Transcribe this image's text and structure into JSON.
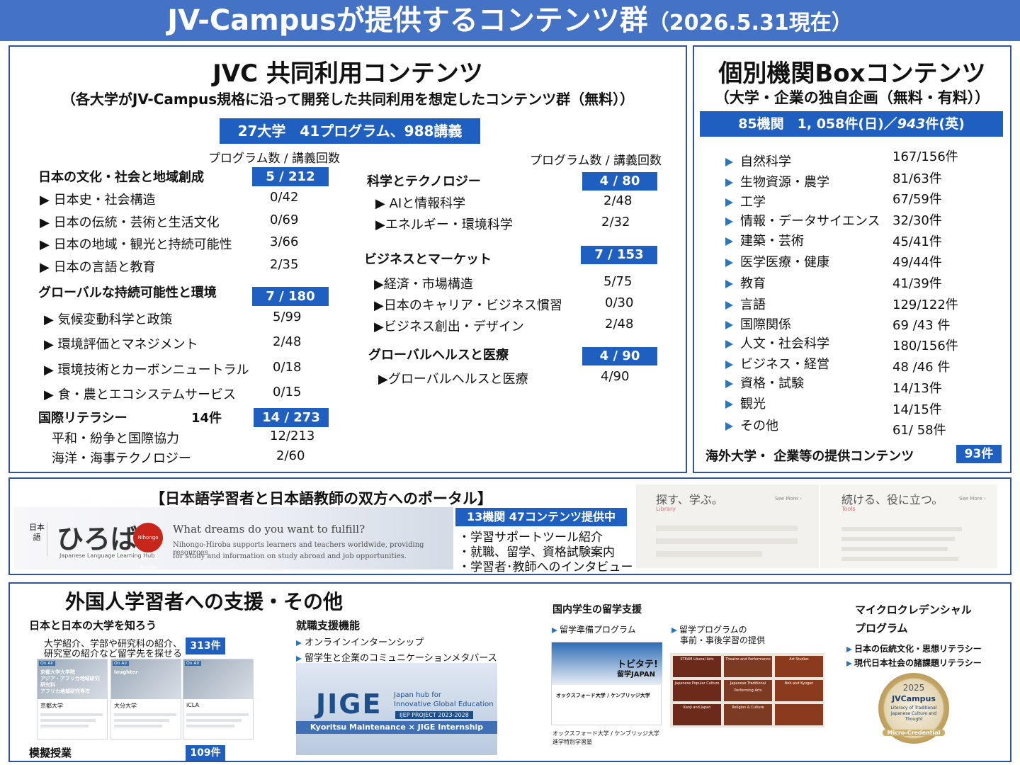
{
  "header": {
    "title": "JV-Campusが提供するコンテンツ群",
    "date": "（2026.5.31現在）"
  },
  "jvc": {
    "title": "JVC 共同利用コンテンツ",
    "subtitle": "（各大学がJV-Campus規格に沿って開発した共同利用を想定したコンテンツ群（無料））",
    "summary": "27大学　41プログラム、988講義",
    "col_header": "プログラム数 / 講義回数",
    "culture": {
      "name": "日本の文化・社会と地域創成",
      "badge": "5 / 212",
      "items": [
        {
          "label": "▶ 日本史・社会構造",
          "value": "0/42"
        },
        {
          "label": "▶ 日本の伝統・芸術と生活文化",
          "value": "0/69"
        },
        {
          "label": "▶ 日本の地域・観光と持続可能性",
          "value": "3/66"
        },
        {
          "label": "▶ 日本の言語と教育",
          "value": "2/35"
        }
      ]
    },
    "global": {
      "name": "グローバルな持続可能性と環境",
      "badge": "7 / 180",
      "items": [
        {
          "label": "▶ 気候変動科学と政策",
          "value": "5/99"
        },
        {
          "label": "▶ 環境評価とマネジメント",
          "value": "2/48"
        },
        {
          "label": "▶ 環境技術とカーボンニュートラル",
          "value": "0/18"
        },
        {
          "label": "▶ 食・農とエコシステムサービス",
          "value": "0/15"
        }
      ]
    },
    "literacy": {
      "name": "国際リテラシー",
      "count": "14件",
      "badge": "14 / 273",
      "items": [
        {
          "label": "平和・紛争と国際協力",
          "value": "12/213"
        },
        {
          "label": "海洋・海事テクノロジー",
          "value": "2/60"
        }
      ]
    },
    "science": {
      "name": "科学とテクノロジー",
      "badge": "4 / 80",
      "items": [
        {
          "label": "▶ AIと情報科学",
          "value": "2/48"
        },
        {
          "label": "▶エネルギー・環境科学",
          "value": "2/32"
        }
      ]
    },
    "business": {
      "name": "ビジネスとマーケット",
      "badge": "7 / 153",
      "items": [
        {
          "label": "▶経済・市場構造",
          "value": "5/75"
        },
        {
          "label": "▶日本のキャリア・ビジネス慣習",
          "value": "0/30"
        },
        {
          "label": "▶ビジネス創出・デザイン",
          "value": "2/48"
        }
      ]
    },
    "health": {
      "name": "グローバルヘルスと医療",
      "badge": "4 / 90",
      "items": [
        {
          "label": "▶グローバルヘルスと医療",
          "value": "4/90"
        }
      ]
    }
  },
  "box": {
    "title": "個別機関Boxコンテンツ",
    "subtitle": "（大学・企業の独自企画（無料・有料））",
    "summary_a": "85機関　1, 058件(日)／",
    "summary_b": "943",
    "summary_c": "件(英)",
    "items": [
      {
        "label": "自然科学",
        "value": "167/156件"
      },
      {
        "label": "生物資源・農学",
        "value": "81/63件"
      },
      {
        "label": "工学",
        "value": "67/59件"
      },
      {
        "label": "情報・データサイエンス",
        "value": "32/30件"
      },
      {
        "label": "建築・芸術",
        "value": "45/41件"
      },
      {
        "label": "医学医療・健康",
        "value": "49/44件"
      },
      {
        "label": "教育",
        "value": "41/39件"
      },
      {
        "label": "言語",
        "value": "129/122件"
      },
      {
        "label": "国際関係",
        "value": "69 /43 件"
      },
      {
        "label": "人文・社会科学",
        "value": "180/156件"
      },
      {
        "label": "ビジネス・経営",
        "value": "48 /46 件"
      },
      {
        "label": "資格・試験",
        "value": "14/13件"
      },
      {
        "label": "観光",
        "value": "14/15件"
      },
      {
        "label": "その他",
        "value": "61/ 58件"
      }
    ],
    "overseas_label": "海外大学・ 企業等の提供コンテンツ",
    "overseas_count": "93件"
  },
  "portal": {
    "title": "【日本語学習者と日本語教師の双方へのポータル】",
    "logo_text": "ひろば",
    "logo_side": "日本語",
    "logo_tag": "Nihongo Hiroba",
    "logo_sub": "Japanese Language Learning Hub",
    "banner_q": "What dreams do you want to fulfill?",
    "banner_d1": "Nihongo-Hiroba supports learners and teachers worldwide,  providing resources",
    "banner_d2": "for study and information on study abroad and job opportunities.",
    "badge": "13機関 47コンテンツ提供中",
    "points": [
      "・学習サポートツール紹介",
      "・就職、留学、資格試験案内",
      "・学習者･教師へのインタビュー"
    ],
    "shot1_title": "探す、学ぶ。",
    "shot1_label": "Library",
    "shot2_title": "続ける、役に立つ。",
    "shot2_label": "Tools",
    "see_more": "See More ›"
  },
  "support": {
    "title": "外国人学習者への支援・その他",
    "japan": {
      "title": "日本と日本の大学を知ろう",
      "desc1": "大学紹介、学部や研究科の紹介、",
      "desc2": "研究室の紹介など留学先を探せる",
      "count": "313件",
      "cards": [
        {
          "tag": "On Air",
          "img_text": "京都大学大学院\nアジア・アフリカ地域研究研究科\nアフリカ地域研究専攻",
          "org": "京都大学"
        },
        {
          "tag": "On Air",
          "img_text": "laughter",
          "org": "大分大学"
        },
        {
          "tag": "On Air",
          "img_text": "",
          "org": "iCLA"
        }
      ]
    },
    "mock": {
      "title": "模擬授業",
      "count": "109件"
    },
    "job": {
      "title": "就職支援機能",
      "items": [
        "オンラインインターンシップ",
        "留学生と企業のコミュニケーションメタバース"
      ],
      "logo": "JIGE",
      "logo_sub1": "Japan hub for",
      "logo_sub2": "Innovative Global Education",
      "project": "IJEP PROJECT 2023-2028",
      "banner": "Kyoritsu Maintenance × JIGE Internship"
    },
    "domestic": {
      "title": "国内学生の留学支援",
      "item1": "留学準備プログラム",
      "item2a": "留学プログラムの",
      "item2b": "事前・事後学習の提供",
      "tobitate1": "トビタテ!",
      "tobitate2": "留学JAPAN",
      "oxford": "オックスフォード大学 / ケンブリッジ大学",
      "caption1": "オックスフォード大学 / ケンブリッジ大学",
      "caption2": "進学特別学習塾",
      "tiles": [
        "STEAM Liberal Arts",
        "Theatre and Performance",
        "Art Studies",
        "Japanese Popular Culture",
        "Japanese Traditional Performing Arts",
        "Noh and Kyogen",
        "Kanji and Japan",
        "Religion & Culture",
        ""
      ]
    },
    "micro": {
      "title1": "マイクロクレデンシャル",
      "title2": "プログラム",
      "items": [
        "日本の伝統文化・思想リテラシー",
        "現代日本社会の諸課題リテラシー"
      ],
      "seal_year": "2025",
      "seal_brand": "JVCampus",
      "seal_text": "Literacy of Traditional Japanese Culture and Thought",
      "seal_ribbon": "Micro-Credential"
    }
  }
}
